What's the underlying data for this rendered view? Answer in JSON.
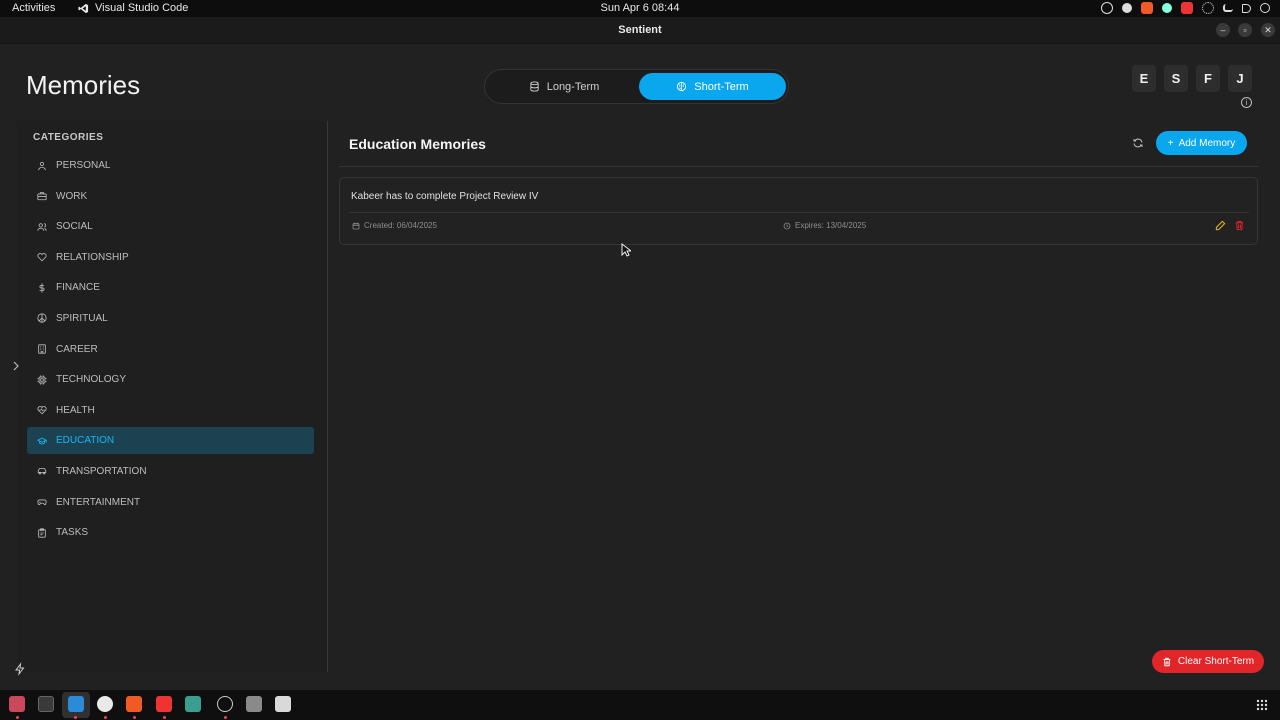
{
  "topbar": {
    "activities": "Activities",
    "app_name": "Visual Studio Code",
    "clock": "Sun Apr 6  08:44"
  },
  "window": {
    "title": "Sentient"
  },
  "page": {
    "title": "Memories"
  },
  "memory_toggle": {
    "long_term": "Long-Term",
    "short_term": "Short-Term",
    "selected": "Short-Term"
  },
  "users": [
    "E",
    "S",
    "F",
    "J"
  ],
  "sidebar": {
    "heading": "CATEGORIES",
    "items": [
      {
        "label": "PERSONAL",
        "icon": "person-icon"
      },
      {
        "label": "WORK",
        "icon": "briefcase-icon"
      },
      {
        "label": "SOCIAL",
        "icon": "users-icon"
      },
      {
        "label": "RELATIONSHIP",
        "icon": "heart-icon"
      },
      {
        "label": "FINANCE",
        "icon": "dollar-icon"
      },
      {
        "label": "SPIRITUAL",
        "icon": "peace-icon"
      },
      {
        "label": "CAREER",
        "icon": "building-icon"
      },
      {
        "label": "TECHNOLOGY",
        "icon": "chip-icon"
      },
      {
        "label": "HEALTH",
        "icon": "heart-pulse-icon"
      },
      {
        "label": "EDUCATION",
        "icon": "graduation-cap-icon",
        "active": true
      },
      {
        "label": "TRANSPORTATION",
        "icon": "car-icon"
      },
      {
        "label": "ENTERTAINMENT",
        "icon": "gamepad-icon"
      },
      {
        "label": "TASKS",
        "icon": "clipboard-icon"
      }
    ]
  },
  "main": {
    "title": "Education Memories",
    "add_button": "Add Memory",
    "memories": [
      {
        "text": "Kabeer has to complete Project Review IV",
        "created": "Created: 06/04/2025",
        "expires": "Expires: 13/04/2025"
      }
    ],
    "clear_button": "Clear Short-Term"
  },
  "colors": {
    "accent": "#0aa7ef",
    "danger": "#e12529",
    "edit": "#e0b21c",
    "active_bg": "#1c4252",
    "active_text": "#18b6f5"
  }
}
